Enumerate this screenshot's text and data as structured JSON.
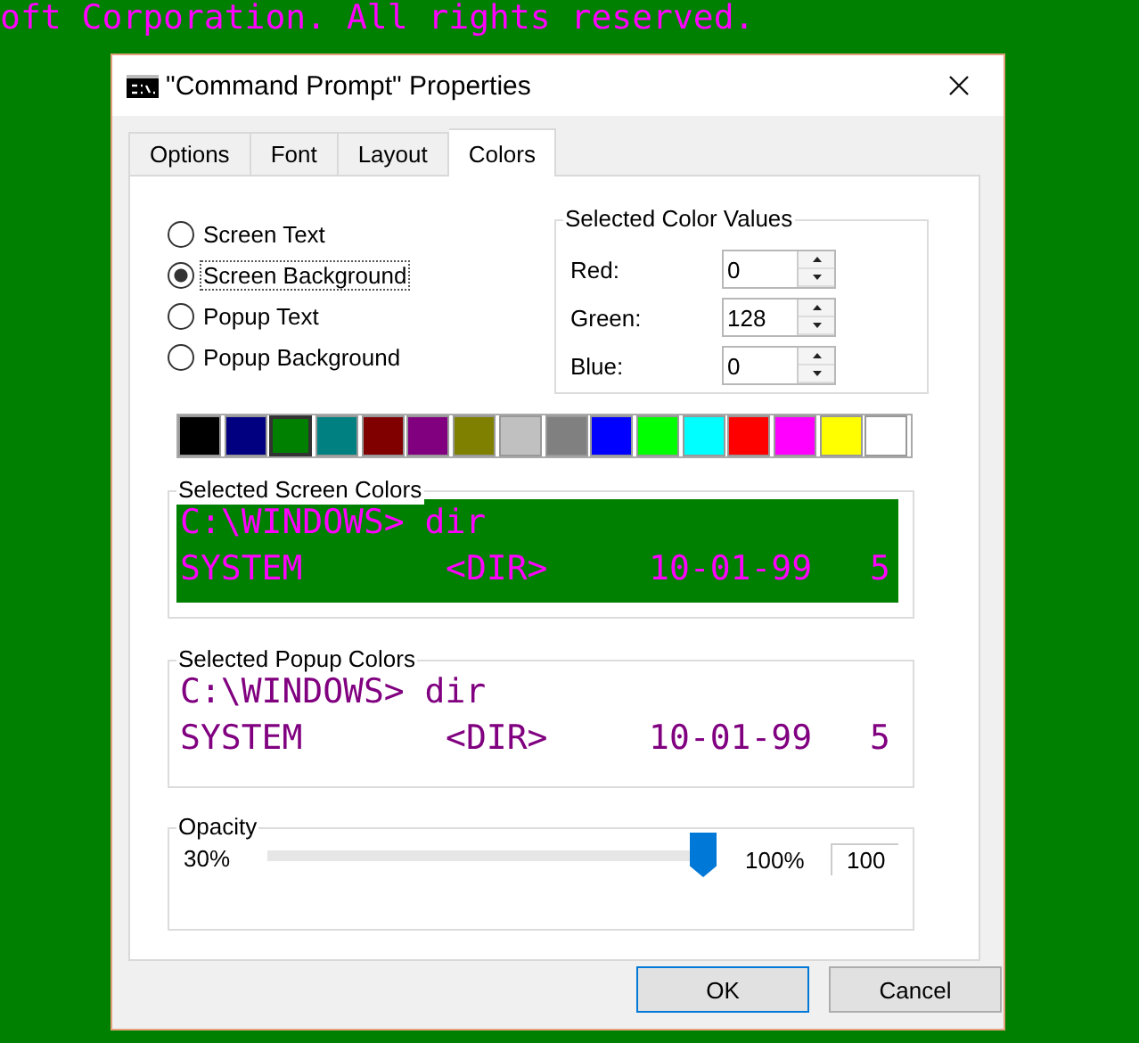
{
  "console_text": "oft Corporation. All rights reserved.",
  "window": {
    "title": "\"Command Prompt\" Properties"
  },
  "tabs": [
    {
      "label": "Options",
      "selected": false
    },
    {
      "label": "Font",
      "selected": false
    },
    {
      "label": "Layout",
      "selected": false
    },
    {
      "label": "Colors",
      "selected": true
    }
  ],
  "color_targets": [
    {
      "label": "Screen Text",
      "selected": false
    },
    {
      "label": "Screen Background",
      "selected": true
    },
    {
      "label": "Popup Text",
      "selected": false
    },
    {
      "label": "Popup Background",
      "selected": false
    }
  ],
  "selected_color_values": {
    "title": "Selected Color Values",
    "fields": [
      {
        "label": "Red:",
        "value": "0"
      },
      {
        "label": "Green:",
        "value": "128"
      },
      {
        "label": "Blue:",
        "value": "0"
      }
    ]
  },
  "palette": [
    {
      "color": "#000000",
      "selected": false
    },
    {
      "color": "#000080",
      "selected": false
    },
    {
      "color": "#008000",
      "selected": true
    },
    {
      "color": "#008080",
      "selected": false
    },
    {
      "color": "#800000",
      "selected": false
    },
    {
      "color": "#800080",
      "selected": false
    },
    {
      "color": "#808000",
      "selected": false
    },
    {
      "color": "#c0c0c0",
      "selected": false
    },
    {
      "color": "#808080",
      "selected": false
    },
    {
      "color": "#0000ff",
      "selected": false
    },
    {
      "color": "#00ff00",
      "selected": false
    },
    {
      "color": "#00ffff",
      "selected": false
    },
    {
      "color": "#ff0000",
      "selected": false
    },
    {
      "color": "#ff00ff",
      "selected": false
    },
    {
      "color": "#ffff00",
      "selected": false
    },
    {
      "color": "#ffffff",
      "selected": false
    }
  ],
  "screen_preview": {
    "title": "Selected Screen Colors",
    "lines": [
      [
        "C:\\WINDOWS> dir"
      ],
      [
        "SYSTEM",
        "<DIR>",
        "10-01-99",
        "5"
      ]
    ]
  },
  "popup_preview": {
    "title": "Selected Popup Colors",
    "lines": [
      [
        "C:\\WINDOWS> dir"
      ],
      [
        "SYSTEM",
        "<DIR>",
        "10-01-99",
        "5"
      ]
    ]
  },
  "opacity": {
    "title": "Opacity",
    "min_label": "30%",
    "max_label": "100%",
    "value": "100",
    "level": 1
  },
  "buttons": [
    {
      "label": "OK",
      "default": true
    },
    {
      "label": "Cancel",
      "default": false
    }
  ]
}
